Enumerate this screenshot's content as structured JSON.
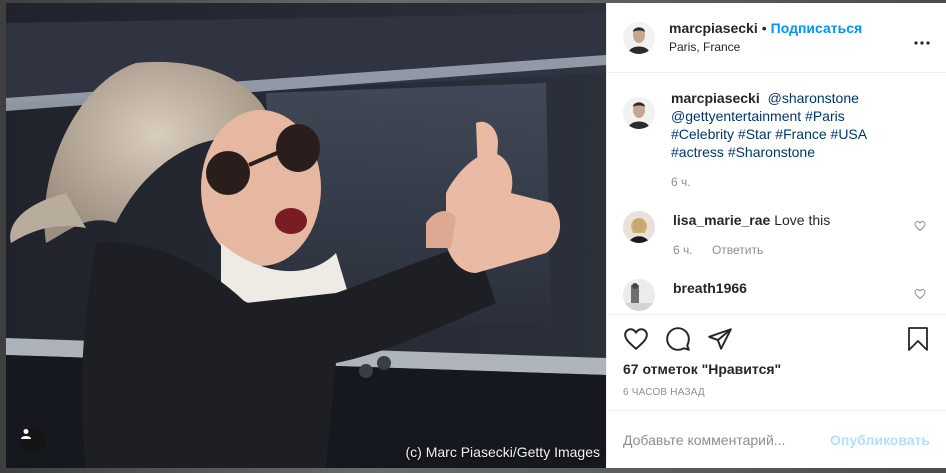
{
  "header": {
    "username": "marcpiasecki",
    "separator": "•",
    "follow_label": "Подписаться",
    "location": "Paris, France",
    "more_label": "•••"
  },
  "photo": {
    "credit": "(c) Marc Piasecki/Getty Images"
  },
  "caption": {
    "username": "marcpiasecki",
    "mention1": "@sharonstone",
    "mention2": "@gettyentertainment",
    "tags": [
      "#Paris",
      "#Celebrity",
      "#Star",
      "#France",
      "#USA",
      "#actress",
      "#Sharonstone"
    ],
    "time": "6 ч."
  },
  "comments": [
    {
      "username": "lisa_marie_rae",
      "text": "Love this ",
      "time": "6 ч.",
      "reply_label": "Ответить"
    },
    {
      "username": "breath1966",
      "text": ""
    }
  ],
  "actions": {
    "likes": "67 отметок \"Нравится\"",
    "timestamp": "6 часов назад"
  },
  "add_comment": {
    "placeholder": "Добавьте комментарий...",
    "publish_label": "Опубликовать"
  },
  "colors": {
    "accent": "#0095f6",
    "publish_disabled": "#b2dffc",
    "muted": "#8e8e8e"
  }
}
